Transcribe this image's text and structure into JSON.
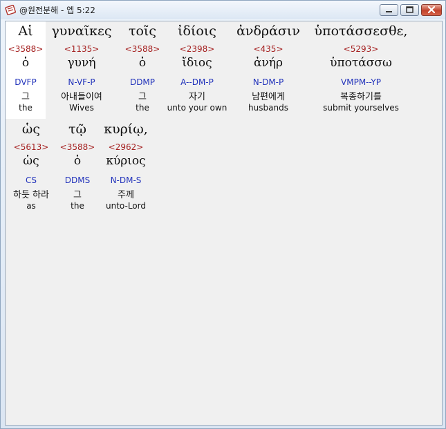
{
  "window": {
    "title": "@원전분해 - 엡 5:22"
  },
  "words": [
    {
      "greek": "Αἱ",
      "strong": "<3588>",
      "lemma": "ὁ",
      "morph": "DVFP",
      "korean": "그",
      "english": "the"
    },
    {
      "greek": "γυναῖκες",
      "strong": "<1135>",
      "lemma": "γυνή",
      "morph": "N-VF-P",
      "korean": "아내들이여",
      "english": "Wives"
    },
    {
      "greek": "τοῖς",
      "strong": "<3588>",
      "lemma": "ὁ",
      "morph": "DDMP",
      "korean": "그",
      "english": "the"
    },
    {
      "greek": "ἰδίοις",
      "strong": "<2398>",
      "lemma": "ἴδιος",
      "morph": "A--DM-P",
      "korean": "자기",
      "english": "unto your own"
    },
    {
      "greek": "ἀνδράσιν",
      "strong": "<435>",
      "lemma": "ἀνήρ",
      "morph": "N-DM-P",
      "korean": "남편에게",
      "english": "husbands"
    },
    {
      "greek": "ὑποτάσσεσθε,",
      "strong": "<5293>",
      "lemma": "ὑποτάσσω",
      "morph": "VMPM--YP",
      "korean": "복종하기를",
      "english": "submit yourselves"
    },
    {
      "greek": "ὡς",
      "strong": "<5613>",
      "lemma": "ὡς",
      "morph": "CS",
      "korean": "하듯 하라",
      "english": "as"
    },
    {
      "greek": "τῷ",
      "strong": "<3588>",
      "lemma": "ὁ",
      "morph": "DDMS",
      "korean": "그",
      "english": "the"
    },
    {
      "greek": "κυρίῳ,",
      "strong": "<2962>",
      "lemma": "κύριος",
      "morph": "N-DM-S",
      "korean": "주께",
      "english": "unto-Lord"
    }
  ]
}
